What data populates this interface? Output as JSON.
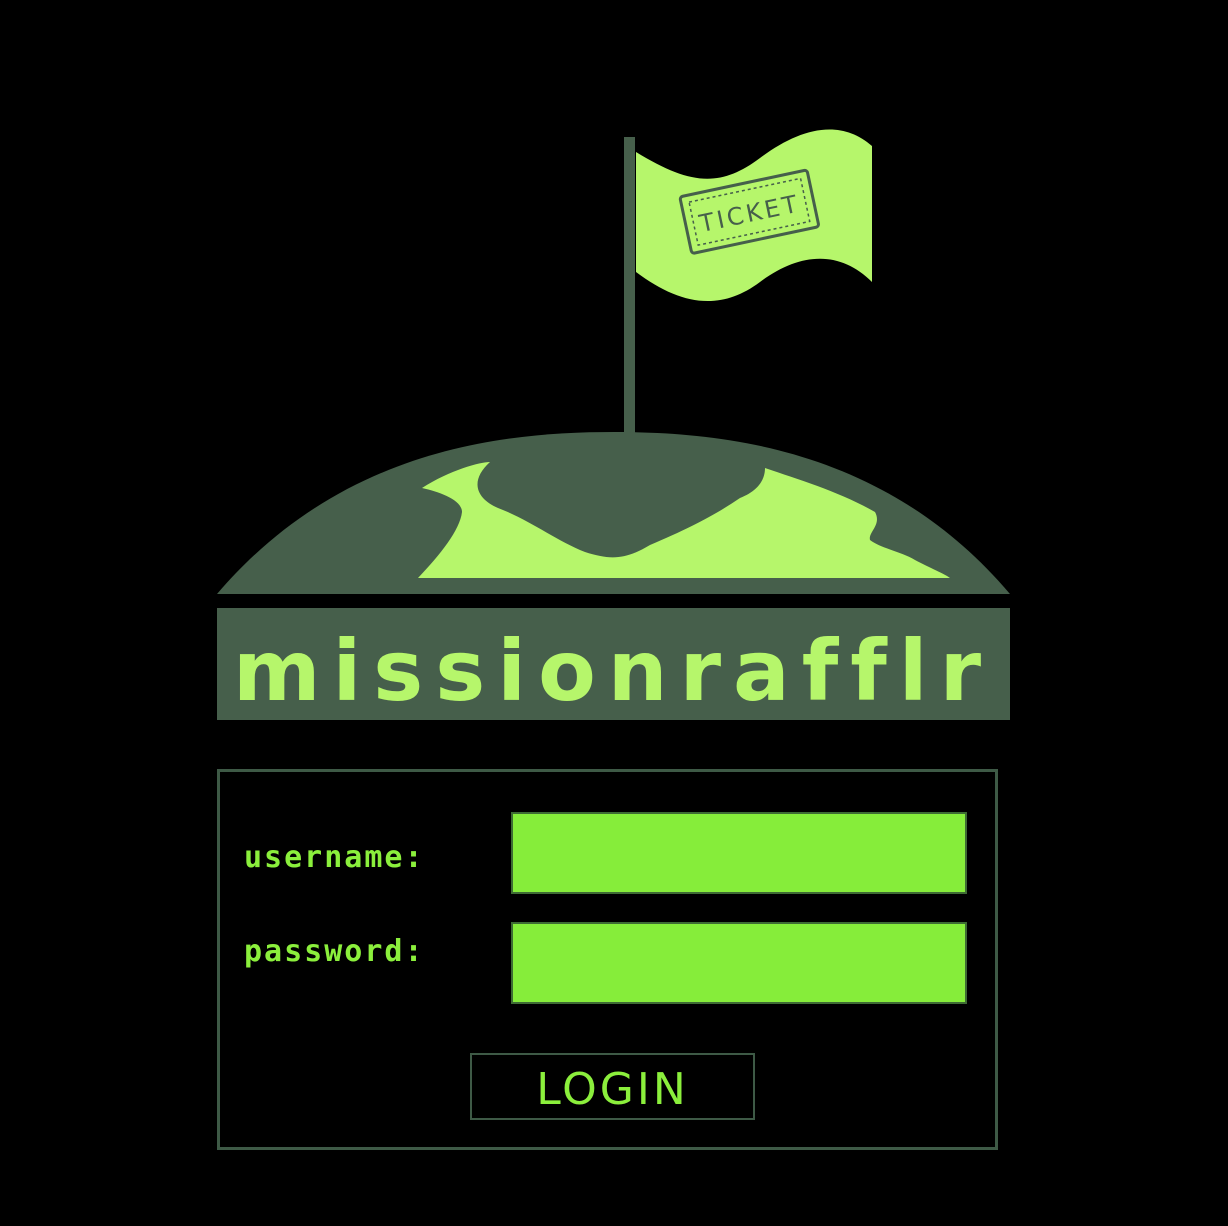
{
  "brand": {
    "name": "missionrafflr",
    "flag_text": "TICKET",
    "colors": {
      "primary_green": "#b6f66b",
      "dark_green": "#465f4b",
      "field_green": "#86ed3a",
      "label_green": "#8bef3c",
      "background": "#000000"
    }
  },
  "login_form": {
    "username_label": "username:",
    "password_label": "password:",
    "username_value": "",
    "password_value": "",
    "login_label": "LOGIN"
  },
  "icons": [
    "flag-icon",
    "ticket-icon",
    "globe-icon"
  ]
}
